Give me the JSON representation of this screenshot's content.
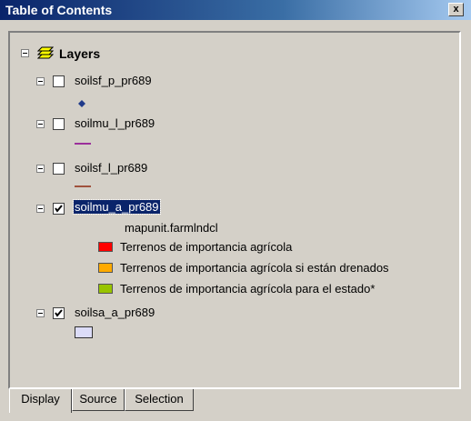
{
  "window": {
    "title": "Table of Contents",
    "close_glyph": "x"
  },
  "root": {
    "label": "Layers",
    "icon": "layers-icon"
  },
  "layers": [
    {
      "name": "soilsf_p_pr689",
      "checked": false,
      "symbol": "diamond-point",
      "symbol_color": "#1f3a8a"
    },
    {
      "name": "soilmu_l_pr689",
      "checked": false,
      "symbol": "line",
      "symbol_color": "#9b2f9b"
    },
    {
      "name": "soilsf_l_pr689",
      "checked": false,
      "symbol": "line",
      "symbol_color": "#a0523d"
    },
    {
      "name": "soilmu_a_pr689",
      "checked": true,
      "selected": true,
      "field": "mapunit.farmlndcl",
      "classes": [
        {
          "label": "Terrenos de importancia agrícola",
          "color": "#ff0000"
        },
        {
          "label": "Terrenos de importancia agrícola si están drenados",
          "color": "#ffaa00"
        },
        {
          "label": "Terrenos de importancia agrícola para el estado*",
          "color": "#98c400"
        }
      ]
    },
    {
      "name": "soilsa_a_pr689",
      "checked": true,
      "symbol": "polygon",
      "symbol_color": "#dcdcf8"
    }
  ],
  "tabs": [
    {
      "label": "Display",
      "active": true
    },
    {
      "label": "Source",
      "active": false
    },
    {
      "label": "Selection",
      "active": false
    }
  ]
}
